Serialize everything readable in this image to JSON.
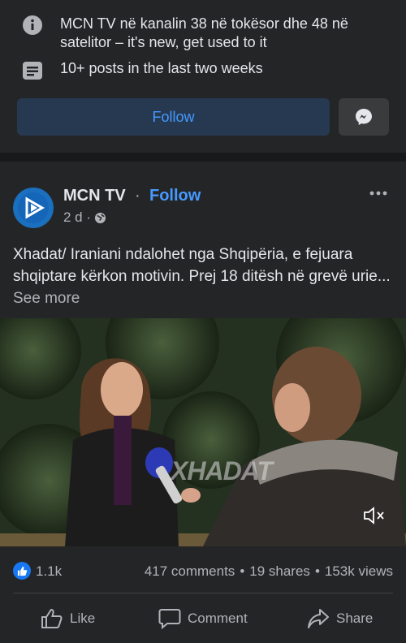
{
  "about": {
    "info_line": "MCN TV në kanalin 38 në tokësor dhe 48 në satelitor – it's new, get used to it",
    "posts_line": "10+ posts in the last two weeks"
  },
  "actions_top": {
    "follow_label": "Follow"
  },
  "post": {
    "page_name": "MCN TV",
    "separator": "·",
    "follow_label": "Follow",
    "time": "2 d ·",
    "text": "Xhadat/ Iraniani ndalohet nga Shqipëria, e fejuara shqiptare kërkon motivin. Prej 18 ditësh në grevë urie...",
    "see_more": "See more",
    "video_watermark": "XHADAT",
    "reactions_count": "1.1k",
    "comments": "417 comments",
    "shares": "19 shares",
    "views": "153k views",
    "dot": "•"
  },
  "post_actions": {
    "like": "Like",
    "comment": "Comment",
    "share": "Share"
  },
  "colors": {
    "background": "#242526",
    "accent": "#4599ff",
    "follow_button_bg": "#263951",
    "muted_text": "#b0b3b8"
  }
}
